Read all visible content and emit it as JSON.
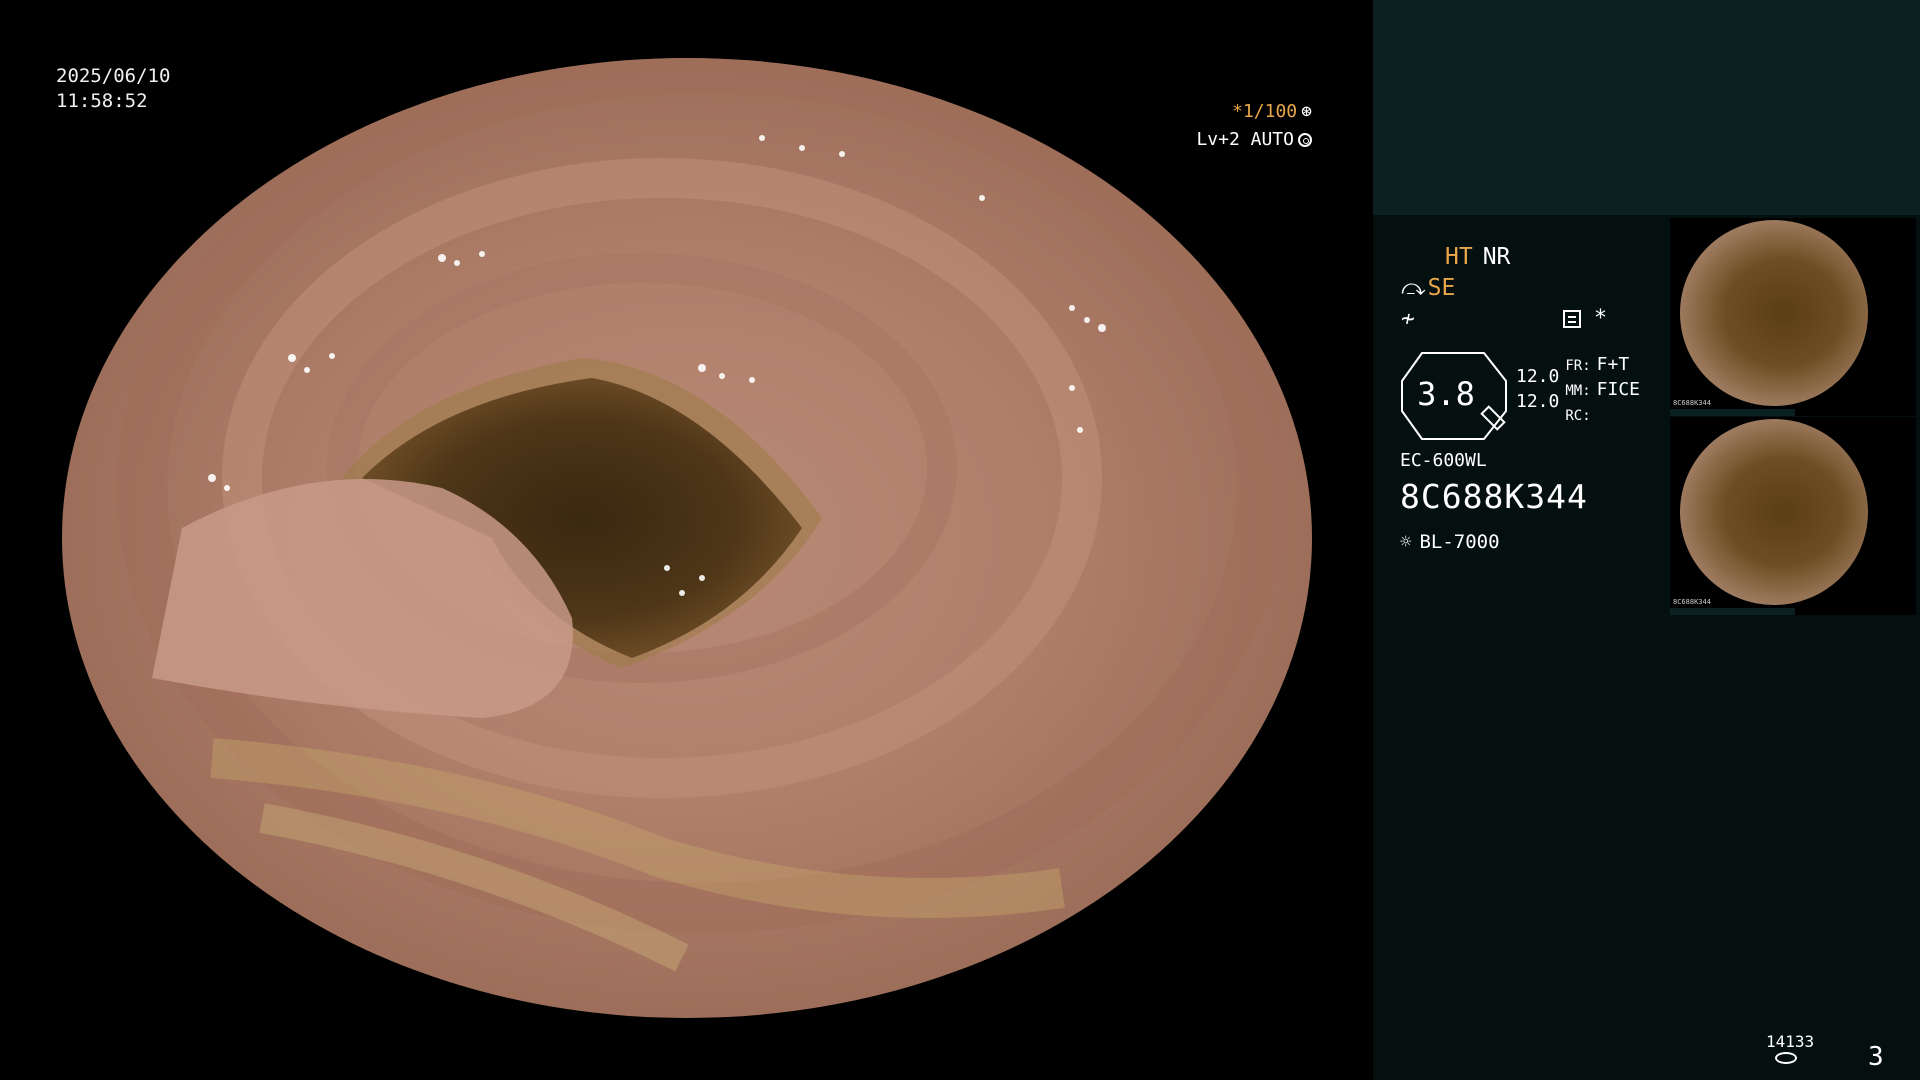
{
  "overlay": {
    "date": "2025/06/10",
    "time": "11:58:52",
    "shutter": "*1/100",
    "iris": "Lv+2 AUTO"
  },
  "panel": {
    "ht": "HT",
    "nr": "NR",
    "se": "SE",
    "asterisk": "*",
    "zoom": "3.8",
    "values": [
      "12.0",
      "12.0"
    ],
    "labels": [
      "FR:",
      "MM:",
      "RC:"
    ],
    "modes": [
      "F+T",
      "FICE",
      ""
    ],
    "model": "EC-600WL",
    "serial": "8C688K344",
    "light_source": "BL-7000",
    "image_count": "14133",
    "page": "3"
  },
  "thumbnails": [
    {
      "caption": "8C688K344"
    },
    {
      "caption": "8C688K344"
    }
  ],
  "colors": {
    "accent": "#e9a64a",
    "panel_bg": "#03100f",
    "panel_top": "#0b2021"
  }
}
